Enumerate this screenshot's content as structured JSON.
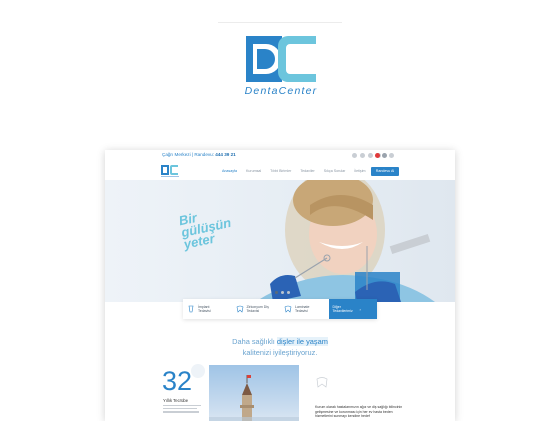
{
  "brand": {
    "name": "DentaCenter",
    "primary_color": "#2a83c8",
    "accent_color": "#6cc5dd"
  },
  "site": {
    "callbar": {
      "label": "Çağrı Merkezi | Randevu:",
      "phone": "444 39 21"
    },
    "nav": {
      "items": [
        "Anasayfa",
        "Kurumsal",
        "Tıbbi Birimler",
        "Tedaviler",
        "Sıkça Sorular",
        "İletişim"
      ],
      "cta_label": "Randevu Al"
    },
    "hero": {
      "title_line1": "Bir",
      "title_line2": "gülüşün",
      "title_line3": "yeter"
    },
    "services": [
      {
        "label": "İmplant Tedavisi",
        "icon": "implant-icon"
      },
      {
        "label": "Zirkonyum Diş Tedavisi",
        "icon": "zirconium-icon"
      },
      {
        "label": "Laminate Tedavisi",
        "icon": "laminate-icon"
      },
      {
        "label": "Diğer Tedavilerimiz",
        "icon": "arrow-icon"
      }
    ],
    "tagline": {
      "part1": "Daha sağlıklı ",
      "highlight": "dişler ile yaşam",
      "part2": "kalitenizi iyileştiriyoruz."
    },
    "stat": {
      "value": "32",
      "label": "Yıllık Tecrübe"
    },
    "about": {
      "text": "Kurum olarak hastalarımızın ağız ve diş sağlığı bilincinin gelişmesine ve korunması için her ev hasta beden hizmetlerini sunmayı kendine hedef"
    }
  }
}
